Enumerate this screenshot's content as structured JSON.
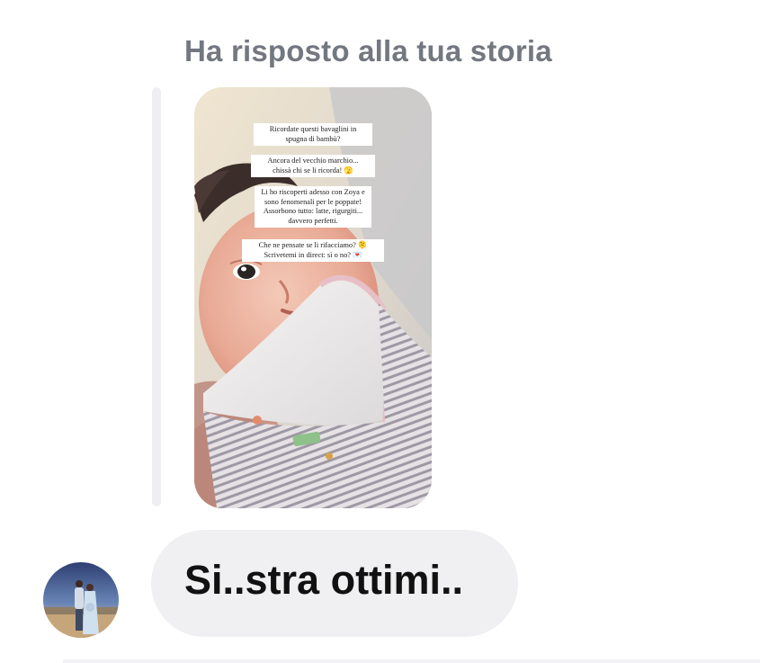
{
  "reply_header": "Ha risposto alla tua storia",
  "story": {
    "captions": [
      "Ricordate questi bavaglini in\nspugna di bambù?",
      "Ancora del vecchio marchio...\nchissà chi se li ricorda! 🫣",
      "Li ho riscoperti adesso con Zoya e\nsono fenomenali per le poppate!\nAssorbono tutto: latte, rigurgiti...\ndavvero perfetti.",
      "Che ne pensate se li rifacciamo? 🫠\nScrivetemi in direct: sì o no? 💌"
    ]
  },
  "message": {
    "text": "Si..stra ottimi.."
  },
  "colors": {
    "header_text": "#737780",
    "bubble_bg": "#f0f0f2",
    "message_text": "#111111"
  }
}
